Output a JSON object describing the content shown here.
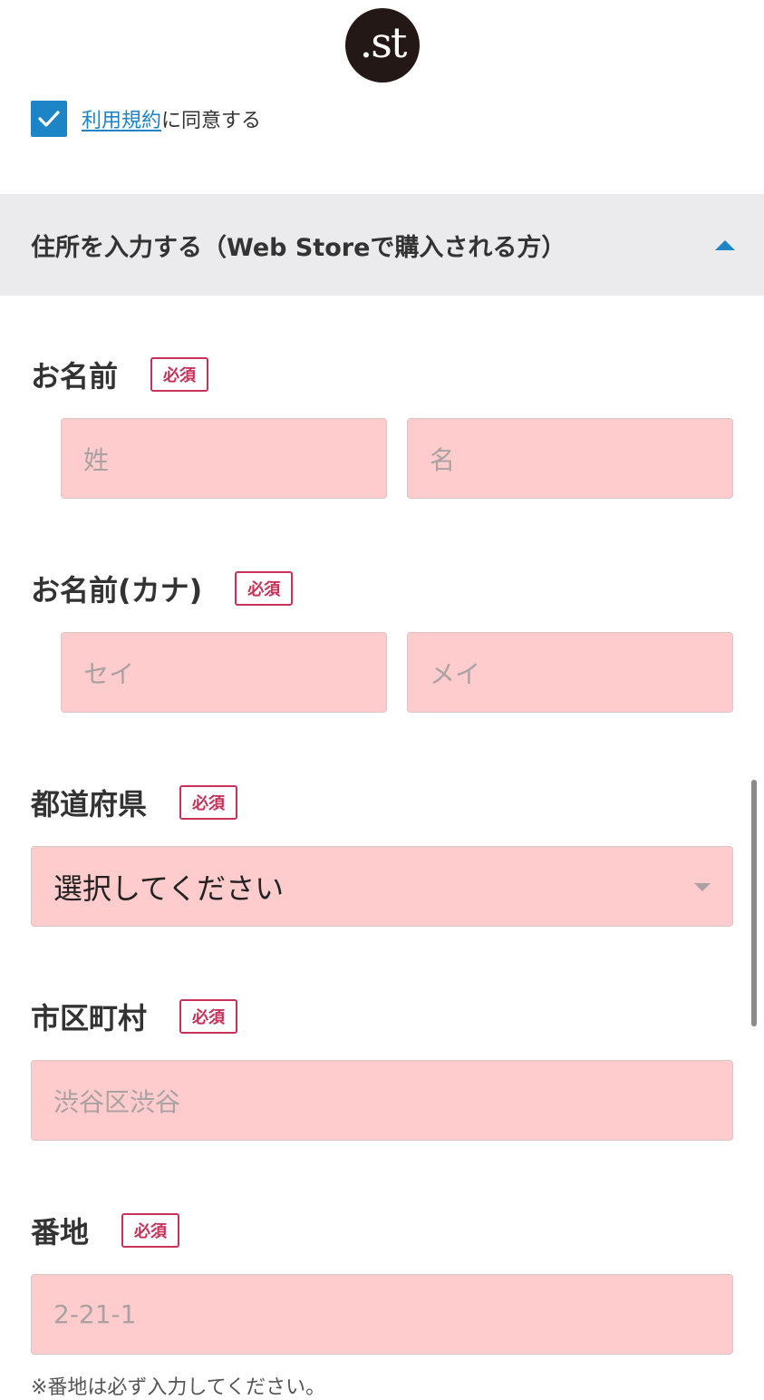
{
  "brand": {
    "logo_text": ".st"
  },
  "terms": {
    "checked": true,
    "link_text": "利用規約",
    "suffix_text": "に同意する"
  },
  "section": {
    "title": "住所を入力する（Web Storeで購入される方）",
    "expanded": true
  },
  "fields": {
    "name": {
      "label": "お名前",
      "required_badge": "必須",
      "last_placeholder": "姓",
      "first_placeholder": "名"
    },
    "kana": {
      "label": "お名前(カナ)",
      "required_badge": "必須",
      "last_placeholder": "セイ",
      "first_placeholder": "メイ"
    },
    "prefecture": {
      "label": "都道府県",
      "required_badge": "必須",
      "selected": "選択してください"
    },
    "city": {
      "label": "市区町村",
      "required_badge": "必須",
      "placeholder": "渋谷区渋谷"
    },
    "street": {
      "label": "番地",
      "required_badge": "必須",
      "placeholder": "2-21-1",
      "note": "※番地は必ず入力してください。"
    }
  },
  "colors": {
    "accent": "#1d84c6",
    "required": "#c8325a",
    "input_error_bg": "#ffcccd",
    "section_bg": "#ebebed"
  }
}
